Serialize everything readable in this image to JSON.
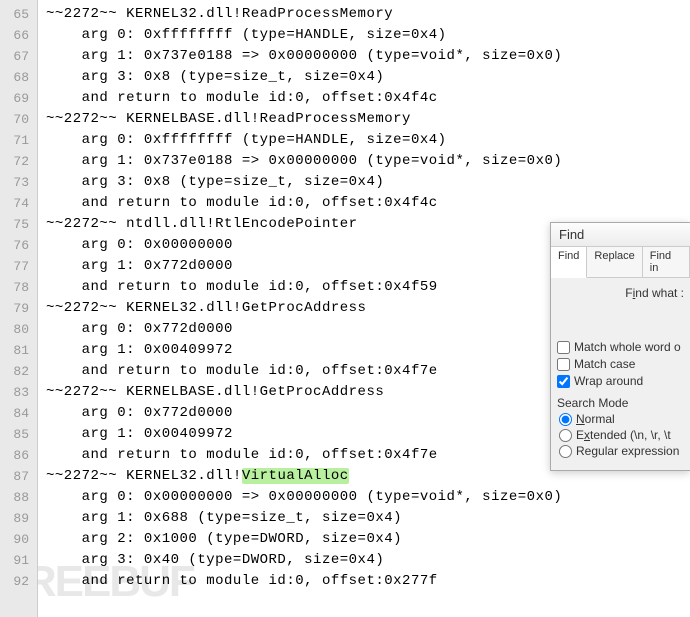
{
  "gutter_start": 65,
  "code_lines": [
    {
      "text": "~~2272~~ KERNEL32.dll!ReadProcessMemory"
    },
    {
      "text": "    arg 0: 0xffffffff (type=HANDLE, size=0x4)"
    },
    {
      "text": "    arg 1: 0x737e0188 => 0x00000000 (type=void*, size=0x0)"
    },
    {
      "text": "    arg 3: 0x8 (type=size_t, size=0x4)"
    },
    {
      "text": "    and return to module id:0, offset:0x4f4c"
    },
    {
      "text": "~~2272~~ KERNELBASE.dll!ReadProcessMemory"
    },
    {
      "text": "    arg 0: 0xffffffff (type=HANDLE, size=0x4)"
    },
    {
      "text": "    arg 1: 0x737e0188 => 0x00000000 (type=void*, size=0x0)"
    },
    {
      "text": "    arg 3: 0x8 (type=size_t, size=0x4)"
    },
    {
      "text": "    and return to module id:0, offset:0x4f4c"
    },
    {
      "text": "~~2272~~ ntdll.dll!RtlEncodePointer"
    },
    {
      "text": "    arg 0: 0x00000000"
    },
    {
      "text": "    arg 1: 0x772d0000"
    },
    {
      "text": "    and return to module id:0, offset:0x4f59"
    },
    {
      "text": "~~2272~~ KERNEL32.dll!GetProcAddress"
    },
    {
      "text": "    arg 0: 0x772d0000"
    },
    {
      "text": "    arg 1: 0x00409972"
    },
    {
      "text": "    and return to module id:0, offset:0x4f7e"
    },
    {
      "text": "~~2272~~ KERNELBASE.dll!GetProcAddress"
    },
    {
      "text": "    arg 0: 0x772d0000"
    },
    {
      "text": "    arg 1: 0x00409972"
    },
    {
      "text": "    and return to module id:0, offset:0x4f7e"
    },
    {
      "prefix": "~~2272~~ KERNEL32.dll!",
      "highlight": "VirtualAlloc"
    },
    {
      "text": "    arg 0: 0x00000000 => 0x00000000 (type=void*, size=0x0)"
    },
    {
      "text": "    arg 1: 0x688 (type=size_t, size=0x4)"
    },
    {
      "text": "    arg 2: 0x1000 (type=DWORD, size=0x4)"
    },
    {
      "text": "    arg 3: 0x40 (type=DWORD, size=0x4)"
    },
    {
      "text": "    and return to module id:0, offset:0x277f"
    }
  ],
  "find": {
    "title": "Find",
    "tabs": [
      "Find",
      "Replace",
      "Find in"
    ],
    "active_tab": 0,
    "find_what_label_pre": "F",
    "find_what_label_u": "i",
    "find_what_label_post": "nd what :",
    "options": {
      "match_whole_word": {
        "label_pre": "Match ",
        "label_u": "w",
        "label_post": "hole word o",
        "checked": false
      },
      "match_case": {
        "label_pre": "Match ",
        "label_u": "c",
        "label_post": "ase",
        "checked": false
      },
      "wrap_around": {
        "label_pre": "Wra",
        "label_u": "p",
        "label_post": " around",
        "checked": true
      }
    },
    "search_mode_label": "Search Mode",
    "search_mode": {
      "normal": {
        "label_u": "N",
        "label_post": "ormal",
        "checked": true
      },
      "extended": {
        "label_pre": "E",
        "label_u": "x",
        "label_post": "tended (\\n, \\r, \\t",
        "checked": false
      },
      "regex": {
        "label_pre": "Re",
        "label_u": "g",
        "label_post": "ular expression",
        "checked": false
      }
    }
  },
  "watermark": "FREEBUF"
}
